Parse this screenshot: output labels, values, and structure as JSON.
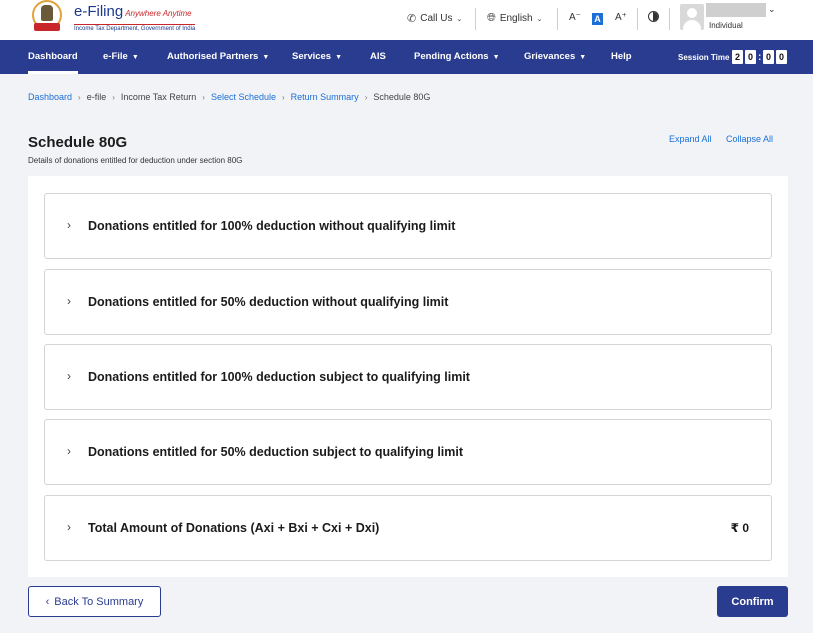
{
  "header": {
    "logo_title": "e-Filing",
    "logo_tagline": "Anywhere Anytime",
    "logo_subtitle": "Income Tax Department, Government of India",
    "call_us": "Call Us",
    "language": "English",
    "font_decrease": "A⁻",
    "font_default": "A",
    "font_increase": "A⁺",
    "user_role": "Individual"
  },
  "nav": {
    "items": [
      {
        "label": "Dashboard",
        "has_dropdown": false,
        "active": true
      },
      {
        "label": "e-File",
        "has_dropdown": true
      },
      {
        "label": "Authorised Partners",
        "has_dropdown": true
      },
      {
        "label": "Services",
        "has_dropdown": true
      },
      {
        "label": "AIS",
        "has_dropdown": false
      },
      {
        "label": "Pending Actions",
        "has_dropdown": true
      },
      {
        "label": "Grievances",
        "has_dropdown": true
      },
      {
        "label": "Help",
        "has_dropdown": false
      }
    ],
    "session_label": "Session Time",
    "timer": [
      "2",
      "0",
      "0",
      "0"
    ]
  },
  "breadcrumb": [
    {
      "label": "Dashboard",
      "link": true
    },
    {
      "label": "e-file",
      "link": false
    },
    {
      "label": "Income Tax Return",
      "link": false
    },
    {
      "label": "Select Schedule",
      "link": true
    },
    {
      "label": "Return Summary",
      "link": true
    },
    {
      "label": "Schedule 80G",
      "link": false
    }
  ],
  "page": {
    "title": "Schedule 80G",
    "subtitle": "Details of donations entitled for deduction under section 80G",
    "expand_all": "Expand All",
    "collapse_all": "Collapse All"
  },
  "sections": [
    {
      "label": "Donations entitled for 100% deduction without qualifying limit",
      "amount": ""
    },
    {
      "label": "Donations entitled for 50% deduction without qualifying limit",
      "amount": ""
    },
    {
      "label": "Donations entitled for 100% deduction subject to qualifying limit",
      "amount": ""
    },
    {
      "label": "Donations entitled for 50% deduction subject to qualifying limit",
      "amount": ""
    },
    {
      "label": "Total Amount of Donations (Axi + Bxi + Cxi + Dxi)",
      "amount": "₹ 0"
    }
  ],
  "footer": {
    "back_label": "Back To Summary",
    "confirm_label": "Confirm"
  },
  "colors": {
    "nav_bg": "#2a3c8f",
    "link": "#1b6fd6",
    "page_bg": "#f2f3f7"
  }
}
